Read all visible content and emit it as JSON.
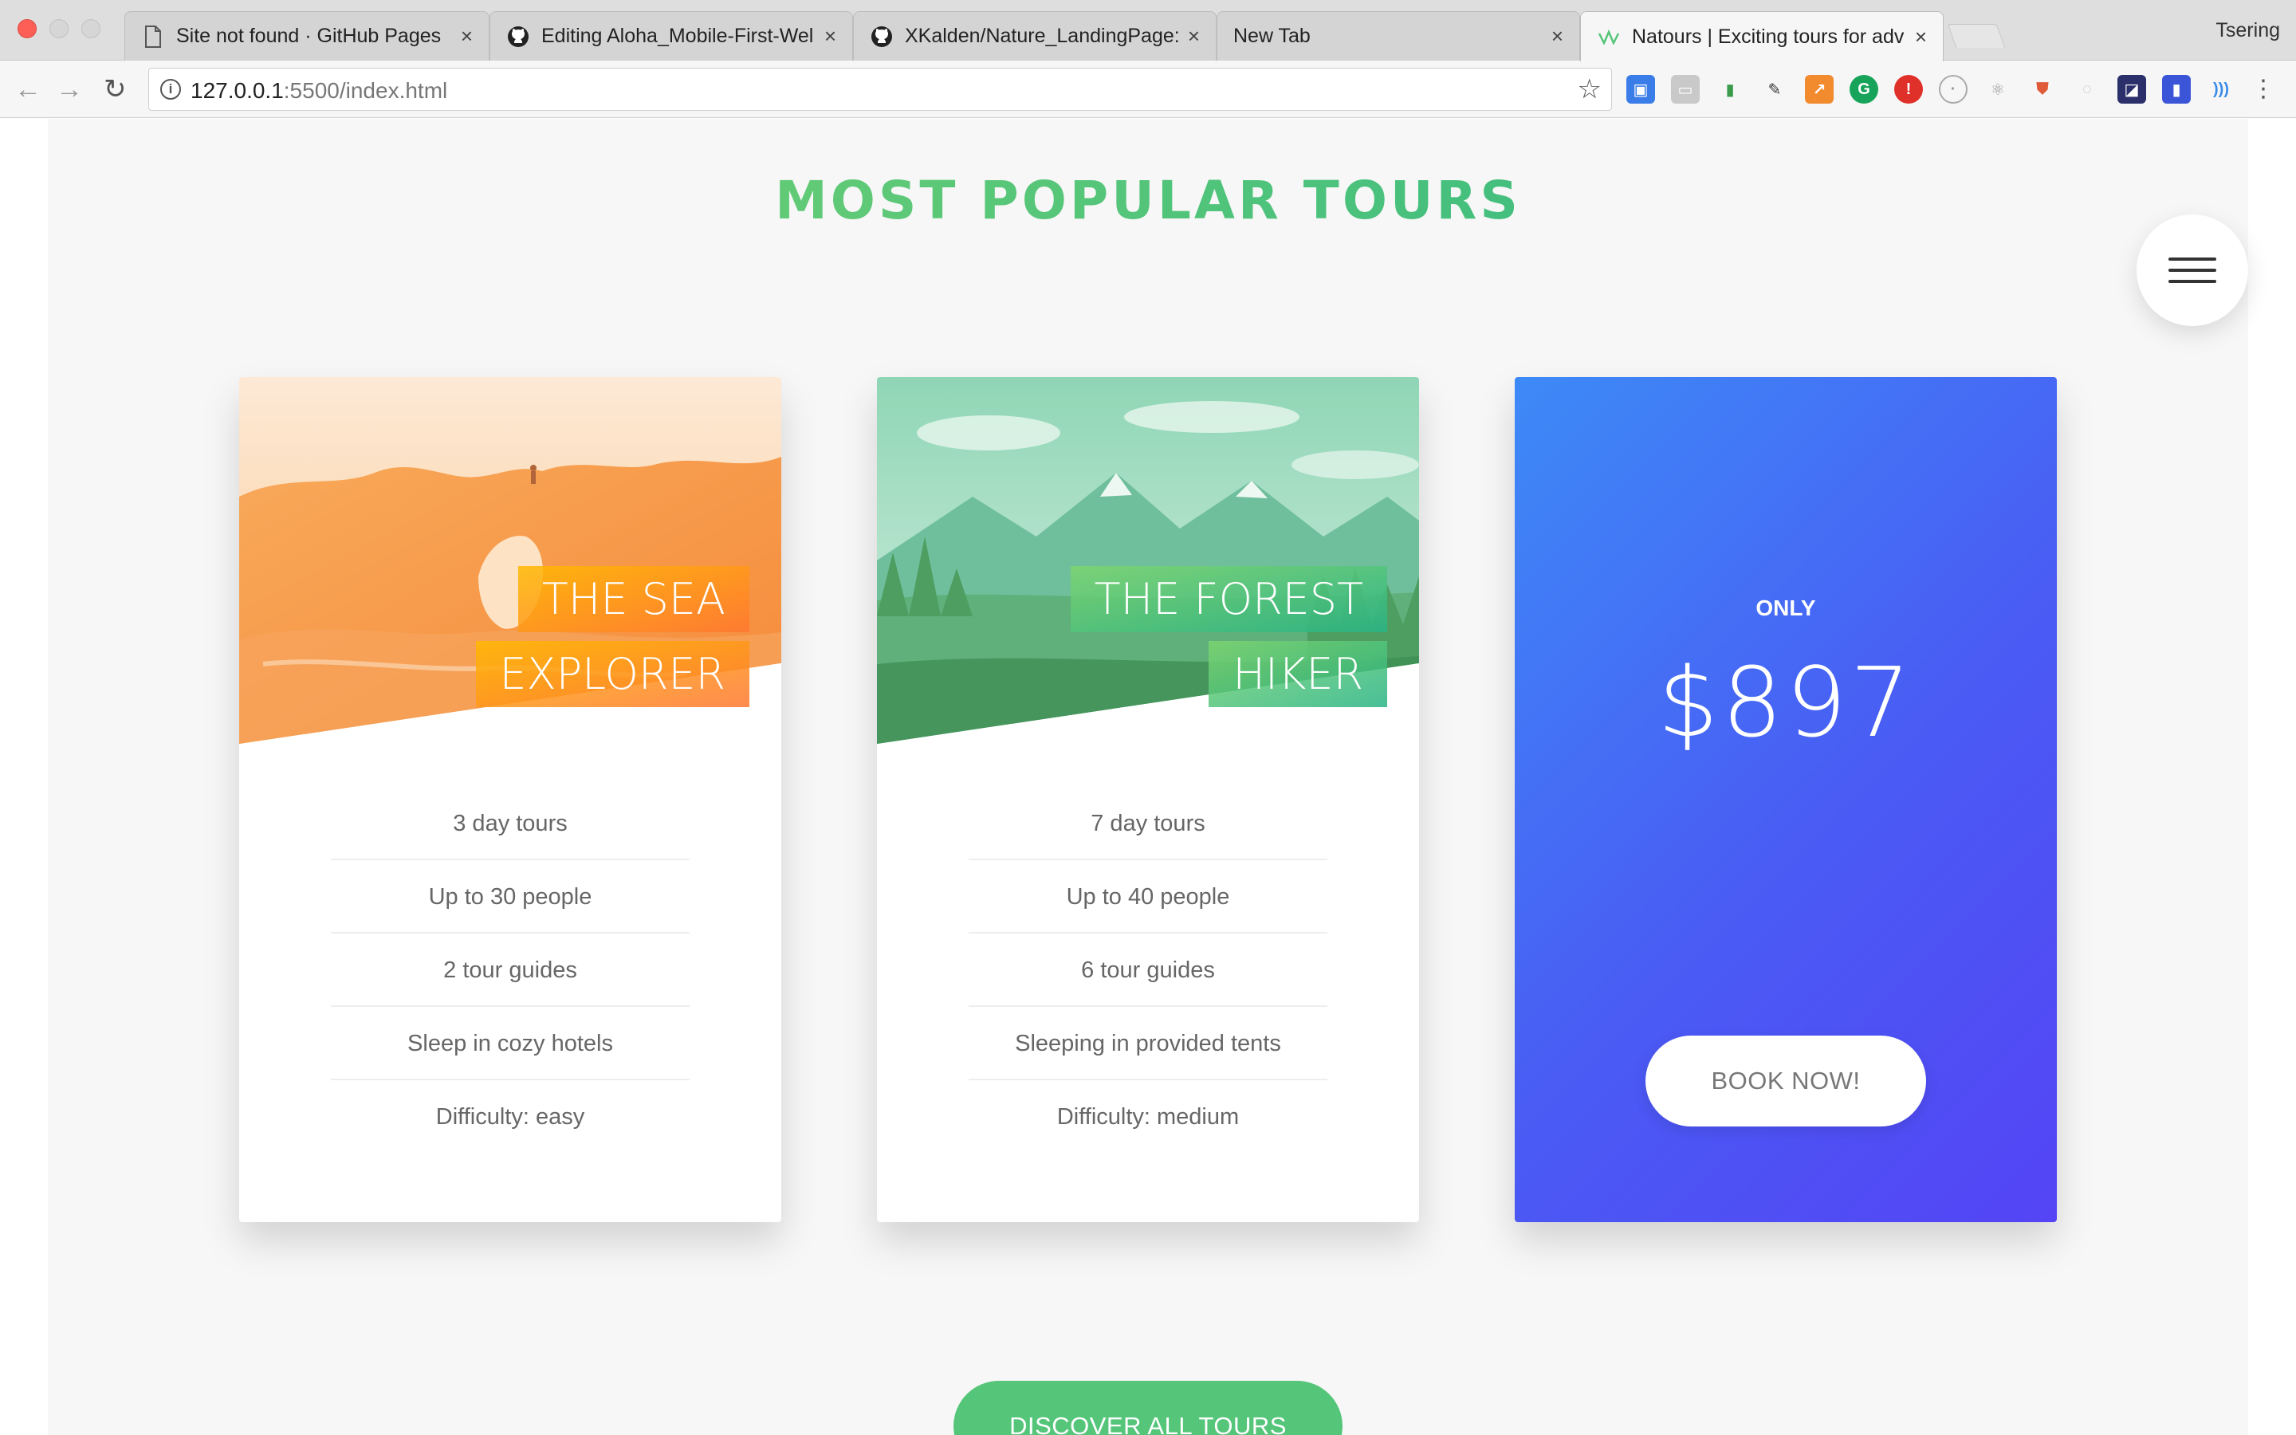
{
  "browser": {
    "tabs": [
      {
        "title": "Site not found · GitHub Pages",
        "icon": "page-icon"
      },
      {
        "title": "Editing Aloha_Mobile-First-Wel",
        "icon": "github-icon"
      },
      {
        "title": "XKalden/Nature_LandingPage:",
        "icon": "github-icon"
      },
      {
        "title": "New Tab",
        "icon": ""
      },
      {
        "title": "Natours | Exciting tours for adv",
        "icon": "natours-icon",
        "active": true
      }
    ],
    "profile_name": "Tsering",
    "url_host": "127.0.0.1",
    "url_rest": ":5500/index.html",
    "close_glyph": "×"
  },
  "page": {
    "section_title": "Most popular tours",
    "cards": [
      {
        "heading_line1": "The Sea",
        "heading_line2": "Explorer",
        "details": [
          "3 day tours",
          "Up to 30 people",
          "2 tour guides",
          "Sleep in cozy hotels",
          "Difficulty: easy"
        ],
        "theme": "orange"
      },
      {
        "heading_line1": "The Forest",
        "heading_line2": "Hiker",
        "details": [
          "7 day tours",
          "Up to 40 people",
          "6 tour guides",
          "Sleeping in provided tents",
          "Difficulty: medium"
        ],
        "theme": "green"
      }
    ],
    "price_card": {
      "only_label": "Only",
      "price": "$897",
      "button_label": "Book now!"
    },
    "discover_button": "Discover all tours"
  },
  "colors": {
    "primary_green": "#55c57a",
    "orange": "#ff7730",
    "blue": "#2998ff",
    "purple": "#5643fa"
  }
}
